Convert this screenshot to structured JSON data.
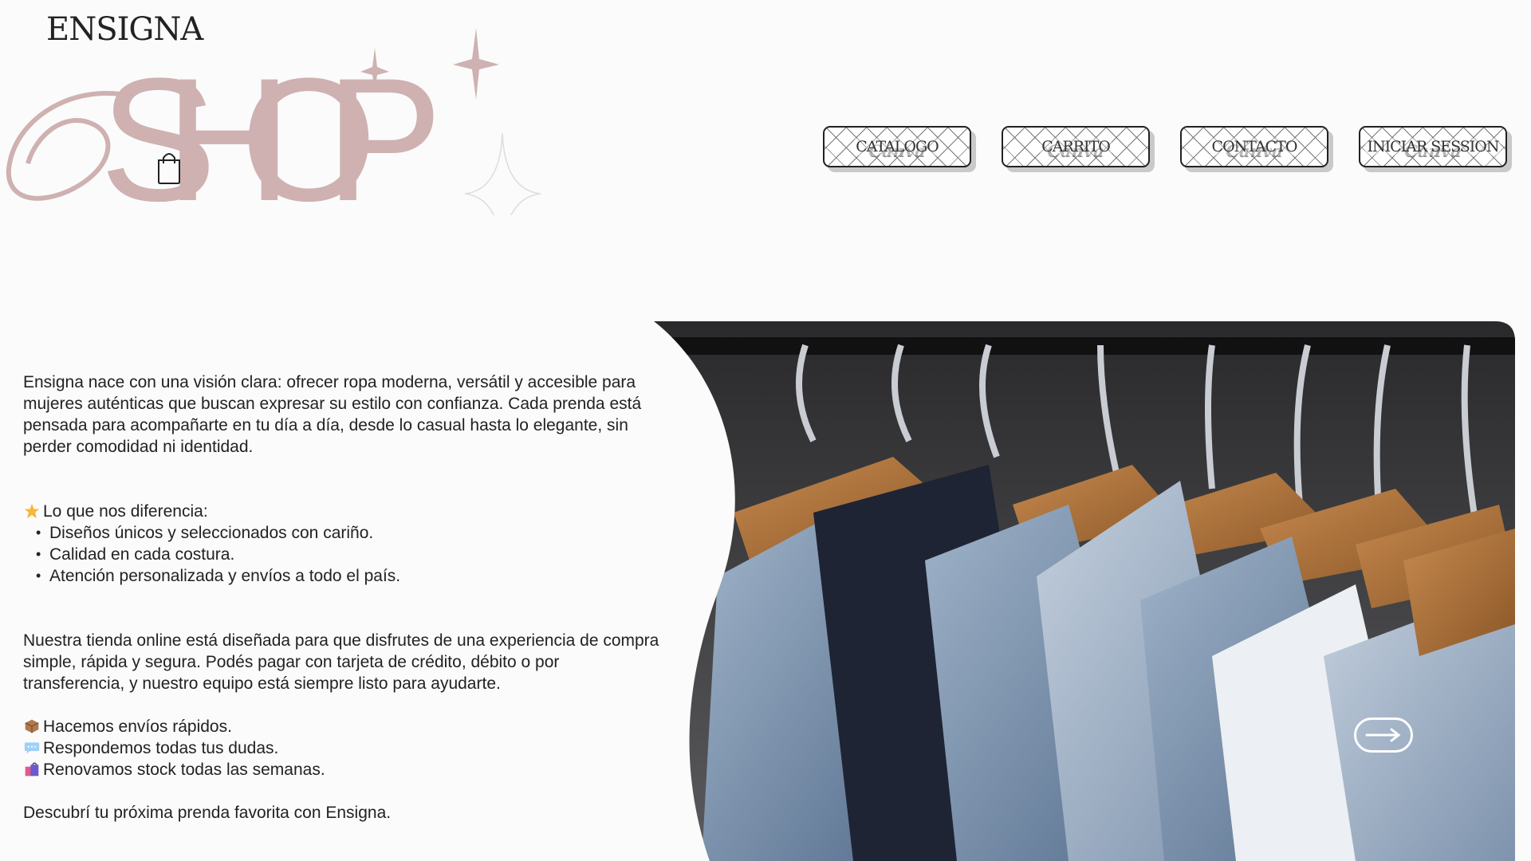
{
  "brand": {
    "name": "ENSIGNA",
    "logo_text": "SHOP"
  },
  "icons": {
    "bag": "shopping-bag-icon",
    "sparkle": "sparkle-icon",
    "arrow": "arrow-right-icon"
  },
  "colors": {
    "logo_pink": "#cfb1b1",
    "background": "#fbfbfb"
  },
  "nav": {
    "items": [
      {
        "label": "CATALOGO",
        "watermark": "Canva"
      },
      {
        "label": "CARRITO",
        "watermark": "Canva"
      },
      {
        "label": "CONTACTO",
        "watermark": "Canva"
      },
      {
        "label": "INICIAR SESSION",
        "watermark": "Canva"
      }
    ]
  },
  "intro": "Ensigna nace con una visión clara: ofrecer ropa moderna, versátil y accesible para mujeres auténticas que buscan expresar su estilo con confianza. Cada prenda está pensada para acompañarte en tu día a día, desde lo casual hasta lo elegante, sin perder comodidad ni identidad.",
  "diff": {
    "title": "Lo que nos diferencia:",
    "items": [
      "Diseños únicos y seleccionados con cariño.",
      "Calidad en cada costura.",
      "Atención personalizada y envíos a todo el país."
    ]
  },
  "store": "Nuestra tienda online está diseñada para que disfrutes de una experiencia de compra simple, rápida y segura. Podés pagar con tarjeta de crédito, débito o por transferencia, y nuestro equipo está siempre listo para ayudarte.",
  "features": [
    {
      "icon": "package-icon",
      "text": "Hacemos envíos rápidos."
    },
    {
      "icon": "speech-bubble-icon",
      "text": "Respondemos todas tus dudas."
    },
    {
      "icon": "shopping-bags-icon",
      "text": "Renovamos stock todas las semanas."
    }
  ],
  "closing": "Descubrí tu próxima prenda favorita con Ensigna."
}
